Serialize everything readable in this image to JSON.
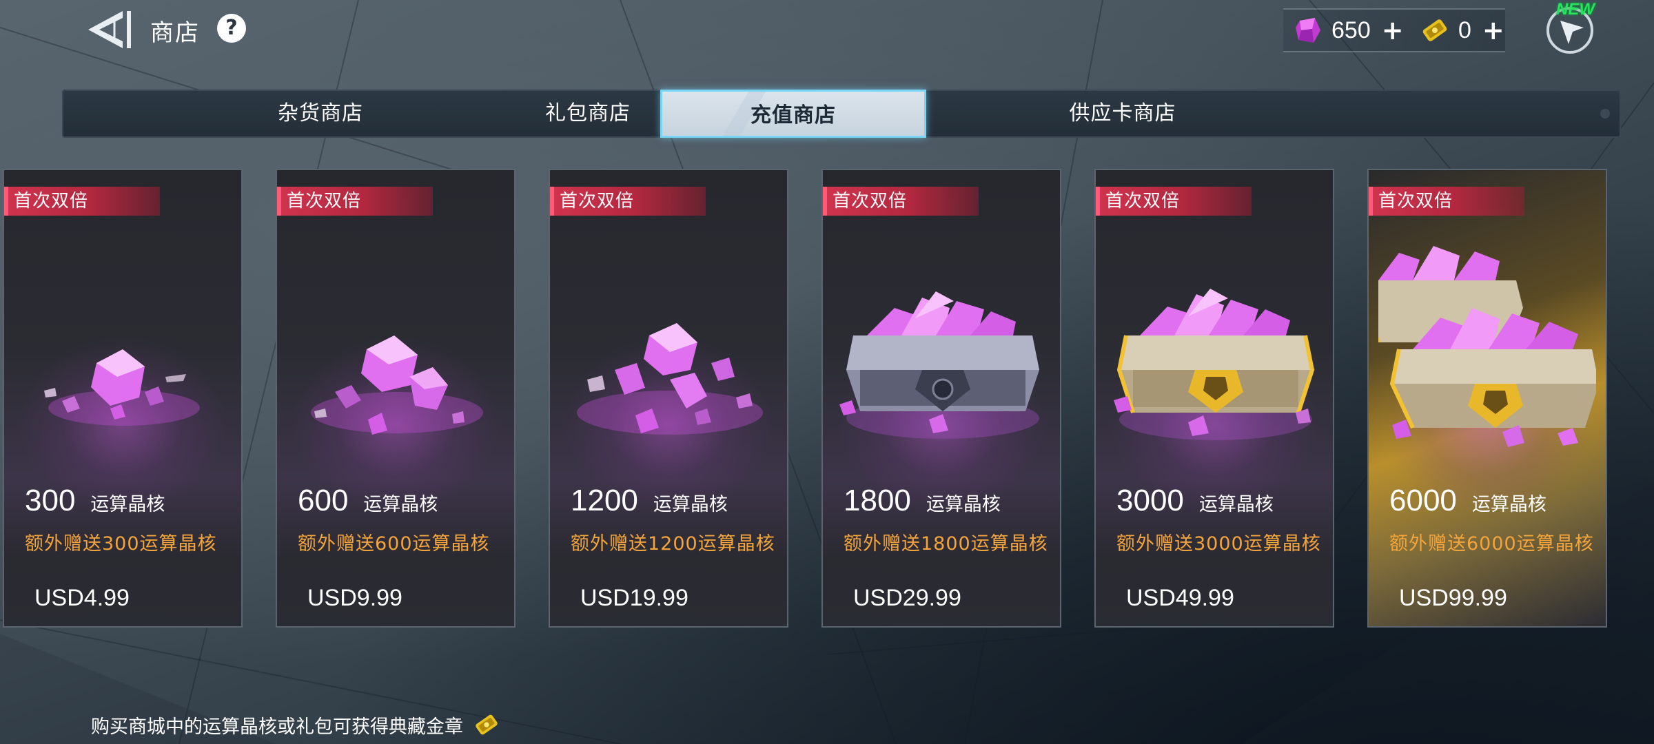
{
  "header": {
    "title": "商店",
    "help": "?",
    "back_icon": "back-arrow-icon",
    "nav_new_badge": "NEW"
  },
  "currencies": [
    {
      "icon": "crystal-icon",
      "value": "650",
      "plus": "+"
    },
    {
      "icon": "gold-medal-icon",
      "value": "0",
      "plus": "+"
    }
  ],
  "tabs": [
    {
      "label": "杂货商店",
      "active": false
    },
    {
      "label": "礼包商店",
      "active": false
    },
    {
      "label": "充值商店",
      "active": true
    },
    {
      "label": "供应卡商店",
      "active": false
    }
  ],
  "products": [
    {
      "badge": "首次双倍",
      "amount": "300",
      "unit": "运算晶核",
      "bonus": "额外赠送300运算晶核",
      "price": "USD4.99"
    },
    {
      "badge": "首次双倍",
      "amount": "600",
      "unit": "运算晶核",
      "bonus": "额外赠送600运算晶核",
      "price": "USD9.99"
    },
    {
      "badge": "首次双倍",
      "amount": "1200",
      "unit": "运算晶核",
      "bonus": "额外赠送1200运算晶核",
      "price": "USD19.99"
    },
    {
      "badge": "首次双倍",
      "amount": "1800",
      "unit": "运算晶核",
      "bonus": "额外赠送1800运算晶核",
      "price": "USD29.99"
    },
    {
      "badge": "首次双倍",
      "amount": "3000",
      "unit": "运算晶核",
      "bonus": "额外赠送3000运算晶核",
      "price": "USD49.99"
    },
    {
      "badge": "首次双倍",
      "amount": "6000",
      "unit": "运算晶核",
      "bonus": "额外赠送6000运算晶核",
      "price": "USD99.99"
    }
  ],
  "footer": {
    "text": "购买商城中的运算晶核或礼包可获得典藏金章",
    "icon": "gold-medal-icon"
  },
  "colors": {
    "accent_tab_border": "#79d5f6",
    "badge_red": "#d1344f",
    "bonus_orange": "#f3a43a",
    "crystal": "#e04ee8"
  }
}
